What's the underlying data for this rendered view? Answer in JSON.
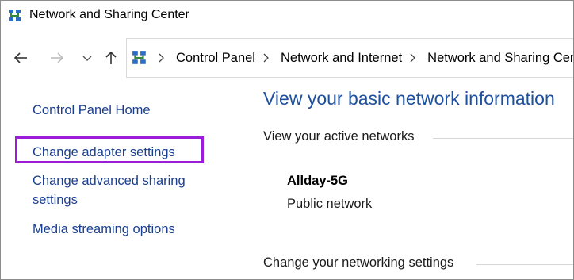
{
  "window": {
    "title": "Network and Sharing Center",
    "title_icon": "network-sharing-center-icon"
  },
  "navigation": {
    "back_icon": "back-arrow-icon",
    "forward_icon": "forward-arrow-icon",
    "recent_icon": "chevron-down-icon",
    "up_icon": "up-arrow-icon",
    "breadcrumbs": [
      "Control Panel",
      "Network and Internet",
      "Network and Sharing Center"
    ]
  },
  "sidebar": {
    "items": [
      {
        "label": "Control Panel Home"
      },
      {
        "label": "Change adapter settings",
        "highlighted": true,
        "highlight_color": "#9b1ddb"
      },
      {
        "label": "Change advanced sharing settings"
      },
      {
        "label": "Media streaming options"
      }
    ]
  },
  "main": {
    "heading": "View your basic network information",
    "active_networks_label": "View your active networks",
    "network": {
      "name": "Allday-5G",
      "type": "Public network"
    },
    "change_settings_label": "Change your networking settings"
  },
  "colors": {
    "link": "#1a3f8f",
    "heading": "#1e50a0",
    "highlight": "#9b1ddb"
  }
}
